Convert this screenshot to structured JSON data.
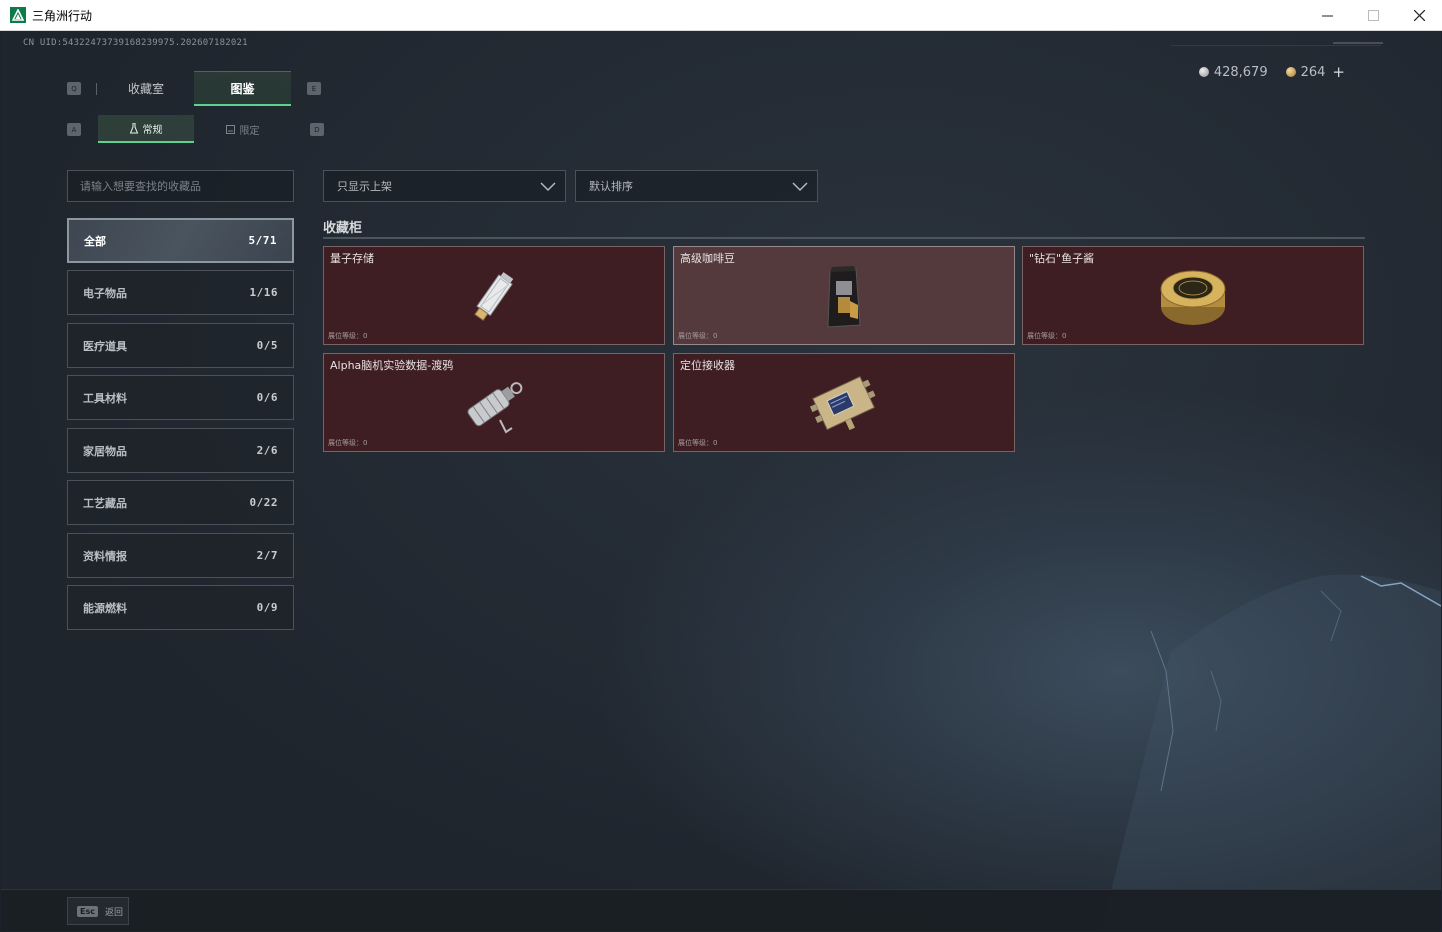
{
  "window": {
    "title": "三角洲行动",
    "controls": {
      "minimize": "—",
      "maximize": "☐",
      "close": "✕"
    }
  },
  "uid": "CN UID:543224737391682399​75.202607182021",
  "currency": {
    "silver": "428,679",
    "gold": "264",
    "add": "+"
  },
  "tabs": {
    "left_key": "Q",
    "right_key": "E",
    "items": [
      {
        "label": "收藏室",
        "active": false
      },
      {
        "label": "图鉴",
        "active": true
      }
    ]
  },
  "subtabs": {
    "left_key": "A",
    "right_key": "D",
    "items": [
      {
        "label": "常规",
        "active": true,
        "icon": "flask-icon"
      },
      {
        "label": "限定",
        "active": false,
        "icon": "badge-icon"
      }
    ]
  },
  "search": {
    "placeholder": "请输入想要查找的收藏品"
  },
  "categories": [
    {
      "label": "全部",
      "count": "5/71",
      "active": true
    },
    {
      "label": "电子物品",
      "count": "1/16"
    },
    {
      "label": "医疗道具",
      "count": "0/5"
    },
    {
      "label": "工具材料",
      "count": "0/6"
    },
    {
      "label": "家居物品",
      "count": "2/6"
    },
    {
      "label": "工艺藏品",
      "count": "0/22"
    },
    {
      "label": "资料情报",
      "count": "2/7"
    },
    {
      "label": "能源燃料",
      "count": "0/9"
    }
  ],
  "filters": {
    "shelf": "只显示上架",
    "sort": "默认排序"
  },
  "cabinet": {
    "title": "收藏柜",
    "items": [
      {
        "name": "量子存储",
        "level": "展位等级：0",
        "icon": "usb-drive-icon"
      },
      {
        "name": "高级咖啡豆",
        "level": "展位等级：0",
        "icon": "coffee-bag-icon",
        "highlight": true
      },
      {
        "name": "\"钻石\"鱼子酱",
        "level": "展位等级：0",
        "icon": "caviar-tin-icon"
      },
      {
        "name": "Alpha脑机实验数据-渡鸦",
        "level": "展位等级：0",
        "icon": "data-capsule-icon"
      },
      {
        "name": "定位接收器",
        "level": "展位等级：0",
        "icon": "gps-receiver-icon"
      }
    ]
  },
  "bottom": {
    "esc_key": "Esc",
    "esc_label": "返回"
  },
  "colors": {
    "accent_green": "#5ed18f",
    "card_red": "#3f1e23",
    "background": "#1c232c"
  }
}
